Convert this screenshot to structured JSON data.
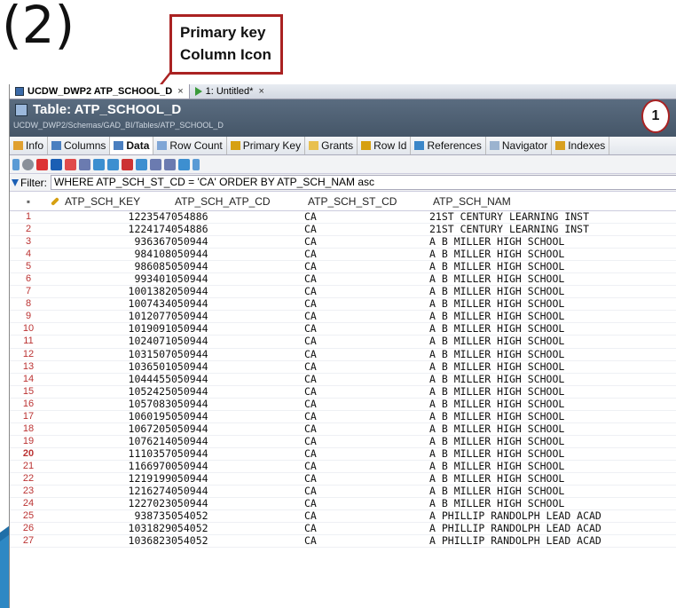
{
  "step_label": "(2)",
  "callout": {
    "line1": "Primary key",
    "line2": "Column Icon"
  },
  "badge": "1",
  "tabs": [
    {
      "label": "UCDW_DWP2 ATP_SCHOOL_D",
      "close": "×"
    },
    {
      "label": "1: Untitled*",
      "close": "×"
    }
  ],
  "header": {
    "title": "Table: ATP_SCHOOL_D",
    "path": "UCDW_DWP2/Schemas/GAD_BI/Tables/ATP_SCHOOL_D"
  },
  "subtabs": [
    "Info",
    "Columns",
    "Data",
    "Row Count",
    "Primary Key",
    "Grants",
    "Row Id",
    "References",
    "Navigator",
    "Indexes"
  ],
  "filter": {
    "label": "Filter:",
    "value": "WHERE ATP_SCH_ST_CD = 'CA' ORDER BY ATP_SCH_NAM asc"
  },
  "grid": {
    "corner": "▪",
    "columns": [
      "ATP_SCH_KEY",
      "ATP_SCH_ATP_CD",
      "ATP_SCH_ST_CD",
      "ATP_SCH_NAM"
    ],
    "rows": [
      [
        "1",
        "1223547",
        "054886",
        "CA",
        "21ST CENTURY LEARNING INST"
      ],
      [
        "2",
        "1224174",
        "054886",
        "CA",
        "21ST CENTURY LEARNING INST"
      ],
      [
        "3",
        "936367",
        "050944",
        "CA",
        "A B MILLER HIGH SCHOOL"
      ],
      [
        "4",
        "984108",
        "050944",
        "CA",
        "A B MILLER HIGH SCHOOL"
      ],
      [
        "5",
        "986085",
        "050944",
        "CA",
        "A B MILLER HIGH SCHOOL"
      ],
      [
        "6",
        "993401",
        "050944",
        "CA",
        "A B MILLER HIGH SCHOOL"
      ],
      [
        "7",
        "1001382",
        "050944",
        "CA",
        "A B MILLER HIGH SCHOOL"
      ],
      [
        "8",
        "1007434",
        "050944",
        "CA",
        "A B MILLER HIGH SCHOOL"
      ],
      [
        "9",
        "1012077",
        "050944",
        "CA",
        "A B MILLER HIGH SCHOOL"
      ],
      [
        "10",
        "1019091",
        "050944",
        "CA",
        "A B MILLER HIGH SCHOOL"
      ],
      [
        "11",
        "1024071",
        "050944",
        "CA",
        "A B MILLER HIGH SCHOOL"
      ],
      [
        "12",
        "1031507",
        "050944",
        "CA",
        "A B MILLER HIGH SCHOOL"
      ],
      [
        "13",
        "1036501",
        "050944",
        "CA",
        "A B MILLER HIGH SCHOOL"
      ],
      [
        "14",
        "1044455",
        "050944",
        "CA",
        "A B MILLER HIGH SCHOOL"
      ],
      [
        "15",
        "1052425",
        "050944",
        "CA",
        "A B MILLER HIGH SCHOOL"
      ],
      [
        "16",
        "1057083",
        "050944",
        "CA",
        "A B MILLER HIGH SCHOOL"
      ],
      [
        "17",
        "1060195",
        "050944",
        "CA",
        "A B MILLER HIGH SCHOOL"
      ],
      [
        "18",
        "1067205",
        "050944",
        "CA",
        "A B MILLER HIGH SCHOOL"
      ],
      [
        "19",
        "1076214",
        "050944",
        "CA",
        "A B MILLER HIGH SCHOOL"
      ],
      [
        "20",
        "1110357",
        "050944",
        "CA",
        "A B MILLER HIGH SCHOOL"
      ],
      [
        "21",
        "1166970",
        "050944",
        "CA",
        "A B MILLER HIGH SCHOOL"
      ],
      [
        "22",
        "1219199",
        "050944",
        "CA",
        "A B MILLER HIGH SCHOOL"
      ],
      [
        "23",
        "1216274",
        "050944",
        "CA",
        "A B MILLER HIGH SCHOOL"
      ],
      [
        "24",
        "1227023",
        "050944",
        "CA",
        "A B MILLER HIGH SCHOOL"
      ],
      [
        "25",
        "938735",
        "054052",
        "CA",
        "A PHILLIP RANDOLPH LEAD ACAD"
      ],
      [
        "26",
        "1031829",
        "054052",
        "CA",
        "A PHILLIP RANDOLPH LEAD ACAD"
      ],
      [
        "27",
        "1036823",
        "054052",
        "CA",
        "A PHILLIP RANDOLPH LEAD ACAD"
      ]
    ]
  },
  "colors": {
    "accent": "#aa2222",
    "header_bg": "#4e6074",
    "row_number": "#bb3333"
  }
}
